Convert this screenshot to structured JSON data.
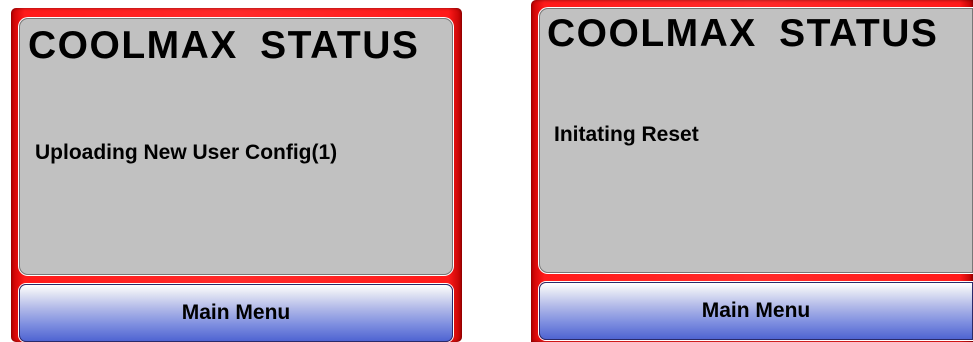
{
  "screens": [
    {
      "title": "COOLMAX  STATUS",
      "message": "Uploading New User Config(1)",
      "button_label": "Main Menu"
    },
    {
      "title": "COOLMAX  STATUS",
      "message": "Initating Reset",
      "button_label": "Main Menu"
    }
  ],
  "colors": {
    "frame": "#ff2a2a",
    "panel": "#c1c1c1",
    "button_top": "#ffffff",
    "button_bottom": "#4f64d2"
  }
}
